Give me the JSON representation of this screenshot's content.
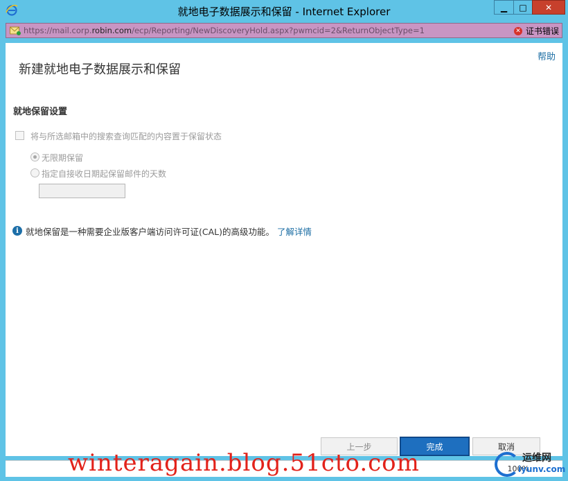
{
  "window": {
    "title": "就地电子数据展示和保留 - Internet Explorer",
    "min_label": "▁",
    "max_label": "□",
    "close_label": "✕"
  },
  "address": {
    "url_prefix": "https://mail.corp.",
    "url_domain": "robin.com",
    "url_suffix": "/ecp/Reporting/NewDiscoveryHold.aspx?pwmcid=2&ReturnObjectType=1",
    "cert_error": "证书错误"
  },
  "page": {
    "help": "帮助",
    "title": "新建就地电子数据展示和保留",
    "section_title": "就地保留设置",
    "checkbox_label": "将与所选邮箱中的搜索查询匹配的内容置于保留状态",
    "radio_indefinite": "无限期保留",
    "radio_days": "指定自接收日期起保留邮件的天数",
    "days_value": "",
    "info_text": "就地保留是一种需要企业版客户端访问许可证(CAL)的高级功能。",
    "info_link": "了解详情"
  },
  "footer": {
    "back": "上一步",
    "finish": "完成",
    "cancel": "取消"
  },
  "statusbar": {
    "zoom": "100%"
  },
  "watermark": {
    "text": "winteragain.blog.51cto.com",
    "logo_text": "运维网",
    "logo_sub": "iyunv.com"
  },
  "colors": {
    "titlebar": "#5fc3e6",
    "addressbar": "#c895c3",
    "primary_button": "#1e6fbf",
    "link": "#1c6ea4",
    "watermark": "#e2221a"
  }
}
